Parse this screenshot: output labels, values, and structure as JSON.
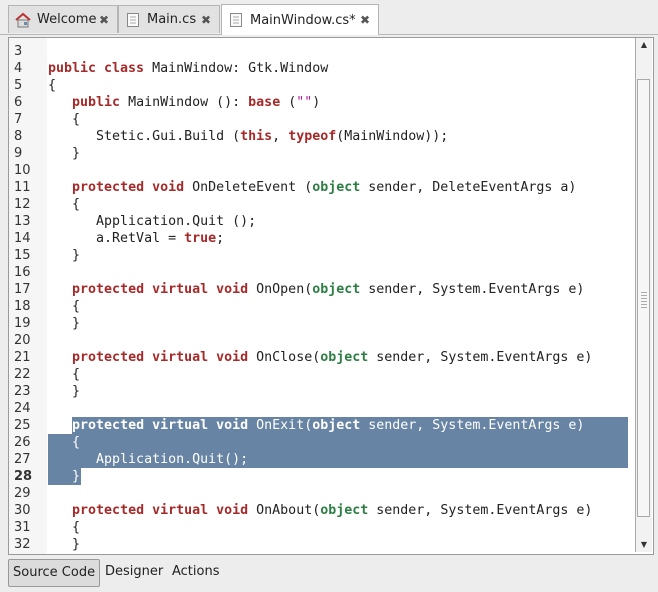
{
  "tabs": [
    {
      "label": "Welcome",
      "icon": "home-icon",
      "active": false
    },
    {
      "label": "Main.cs",
      "icon": "document-icon",
      "active": false
    },
    {
      "label": "MainWindow.cs*",
      "icon": "document-icon",
      "active": true
    }
  ],
  "close_glyph": "✖",
  "colors": {
    "keyword": "#a52a2a",
    "type": "#2e7d44",
    "string": "#c020a0",
    "selection": "#6784a4"
  },
  "editor": {
    "current_line": 28,
    "selection": {
      "from_line": 25,
      "to_line": 28
    },
    "lines": [
      {
        "n": "3",
        "t": []
      },
      {
        "n": "4",
        "t": [
          [
            "kw",
            "public class"
          ],
          [
            "p",
            " MainWindow: Gtk.Window"
          ]
        ]
      },
      {
        "n": "5",
        "t": [
          [
            "p",
            "{"
          ]
        ]
      },
      {
        "n": "6",
        "t": [
          [
            "p",
            "   "
          ],
          [
            "kw",
            "public"
          ],
          [
            "p",
            " MainWindow (): "
          ],
          [
            "kw",
            "base"
          ],
          [
            "p",
            " ("
          ],
          [
            "str",
            "\"\""
          ],
          [
            "p",
            ")"
          ]
        ]
      },
      {
        "n": "7",
        "t": [
          [
            "p",
            "   {"
          ]
        ]
      },
      {
        "n": "8",
        "t": [
          [
            "p",
            "      Stetic.Gui.Build ("
          ],
          [
            "kw",
            "this"
          ],
          [
            "p",
            ", "
          ],
          [
            "kw",
            "typeof"
          ],
          [
            "p",
            "(MainWindow));"
          ]
        ]
      },
      {
        "n": "9",
        "t": [
          [
            "p",
            "   }"
          ]
        ]
      },
      {
        "n": "10",
        "t": []
      },
      {
        "n": "11",
        "t": [
          [
            "p",
            "   "
          ],
          [
            "kw",
            "protected void"
          ],
          [
            "p",
            " OnDeleteEvent ("
          ],
          [
            "ty",
            "object"
          ],
          [
            "p",
            " sender, DeleteEventArgs a)"
          ]
        ]
      },
      {
        "n": "12",
        "t": [
          [
            "p",
            "   {"
          ]
        ]
      },
      {
        "n": "13",
        "t": [
          [
            "p",
            "      Application.Quit ();"
          ]
        ]
      },
      {
        "n": "14",
        "t": [
          [
            "p",
            "      a.RetVal = "
          ],
          [
            "kw",
            "true"
          ],
          [
            "p",
            ";"
          ]
        ]
      },
      {
        "n": "15",
        "t": [
          [
            "p",
            "   }"
          ]
        ]
      },
      {
        "n": "16",
        "t": []
      },
      {
        "n": "17",
        "t": [
          [
            "p",
            "   "
          ],
          [
            "kw",
            "protected virtual void"
          ],
          [
            "p",
            " OnOpen("
          ],
          [
            "ty",
            "object"
          ],
          [
            "p",
            " sender, System.EventArgs e)"
          ]
        ]
      },
      {
        "n": "18",
        "t": [
          [
            "p",
            "   {"
          ]
        ]
      },
      {
        "n": "19",
        "t": [
          [
            "p",
            "   }"
          ]
        ]
      },
      {
        "n": "20",
        "t": []
      },
      {
        "n": "21",
        "t": [
          [
            "p",
            "   "
          ],
          [
            "kw",
            "protected virtual void"
          ],
          [
            "p",
            " OnClose("
          ],
          [
            "ty",
            "object"
          ],
          [
            "p",
            " sender, System.EventArgs e)"
          ]
        ]
      },
      {
        "n": "22",
        "t": [
          [
            "p",
            "   {"
          ]
        ]
      },
      {
        "n": "23",
        "t": [
          [
            "p",
            "   }"
          ]
        ]
      },
      {
        "n": "24",
        "t": []
      },
      {
        "n": "25",
        "t": [
          [
            "p",
            "   "
          ],
          [
            "kw",
            "protected virtual void"
          ],
          [
            "p",
            " OnExit("
          ],
          [
            "ty",
            "object"
          ],
          [
            "p",
            " sender, System.EventArgs e)"
          ]
        ]
      },
      {
        "n": "26",
        "t": [
          [
            "p",
            "   {"
          ]
        ]
      },
      {
        "n": "27",
        "t": [
          [
            "p",
            "      Application.Quit();"
          ]
        ]
      },
      {
        "n": "28",
        "t": [
          [
            "p",
            "   }"
          ]
        ]
      },
      {
        "n": "29",
        "t": []
      },
      {
        "n": "30",
        "t": [
          [
            "p",
            "   "
          ],
          [
            "kw",
            "protected virtual void"
          ],
          [
            "p",
            " OnAbout("
          ],
          [
            "ty",
            "object"
          ],
          [
            "p",
            " sender, System.EventArgs e)"
          ]
        ]
      },
      {
        "n": "31",
        "t": [
          [
            "p",
            "   {"
          ]
        ]
      },
      {
        "n": "32",
        "t": [
          [
            "p",
            "   }"
          ]
        ]
      }
    ]
  },
  "scrollbar": {
    "up": "▲",
    "down": "▼",
    "position_fraction": 0.05
  },
  "bottom_tabs": [
    {
      "label": "Source Code",
      "active": true
    },
    {
      "label": "Designer",
      "active": false
    },
    {
      "label": "Actions",
      "active": false
    }
  ]
}
